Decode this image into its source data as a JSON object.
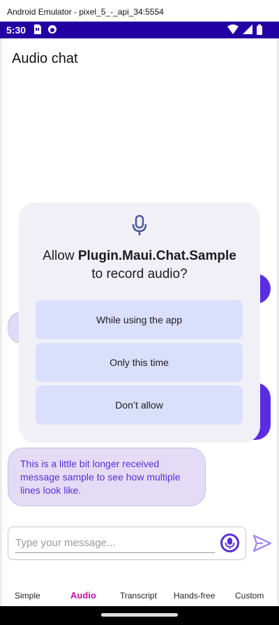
{
  "window": {
    "title": "Android Emulator - pixel_5_-_api_34:5554"
  },
  "status_bar": {
    "time": "5:30"
  },
  "page": {
    "title": "Audio chat"
  },
  "dialog": {
    "title_prefix": "Allow ",
    "app_name": "Plugin.Maui.Chat.Sample",
    "title_suffix": "to record audio?",
    "buttons": {
      "while_using": "While using the app",
      "only_this_time": "Only this time",
      "dont_allow": "Don’t allow"
    }
  },
  "messages": {
    "received_long": "This is a little bit longer received message sample to see how multiple lines look like."
  },
  "composer": {
    "placeholder": "Type your message..."
  },
  "tabs": [
    {
      "label": "Simple"
    },
    {
      "label": "Audio"
    },
    {
      "label": "Transcript"
    },
    {
      "label": "Hands-free"
    },
    {
      "label": "Custom"
    }
  ],
  "colors": {
    "status_bar": "#2200a4",
    "accent_purple": "#5a2fd5",
    "active_tab": "#c1119f",
    "dialog_bg": "#f1f0f6",
    "perm_button_bg": "#dae0fc"
  }
}
